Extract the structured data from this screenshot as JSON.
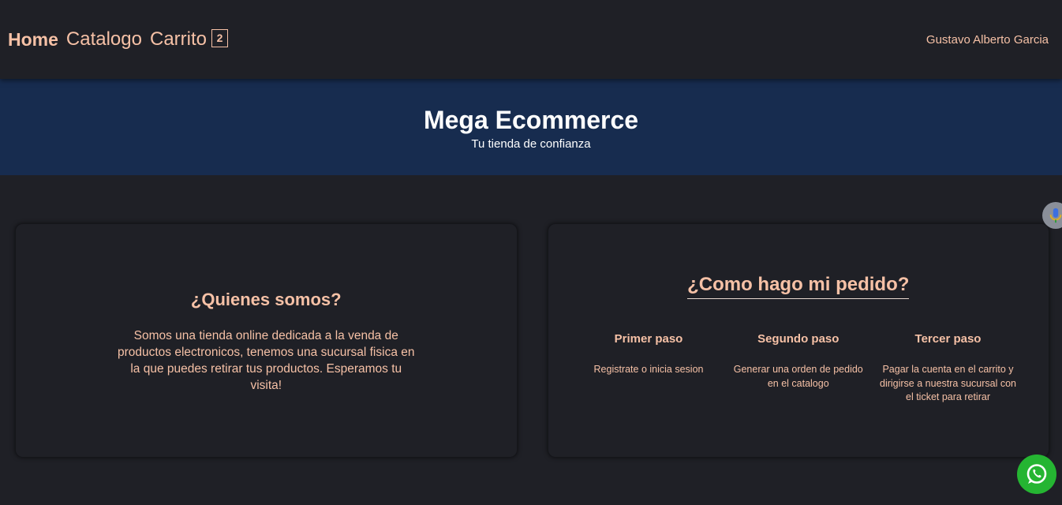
{
  "nav": {
    "home_label": "Home",
    "catalog_label": "Catalogo",
    "cart_label": "Carrito",
    "cart_count": "2",
    "user_name": "Gustavo Alberto Garcia"
  },
  "hero": {
    "title": "Mega Ecommerce",
    "subtitle": "Tu tienda de confianza"
  },
  "about": {
    "title": "¿Quienes somos?",
    "text": "Somos una tienda online dedicada a la venda de productos electronicos, tenemos una sucursal fisica en la que puedes retirar tus productos. Esperamos tu visita!"
  },
  "order": {
    "title": "¿Como hago mi pedido?",
    "steps": [
      {
        "title": "Primer paso",
        "text": "Registrate o inicia sesion"
      },
      {
        "title": "Segundo paso",
        "text": "Generar una orden de pedido en el catalogo"
      },
      {
        "title": "Tercer paso",
        "text": "Pagar la cuenta en el carrito y dirigirse a nuestra sucursal con el ticket para retirar"
      }
    ]
  },
  "icons": {
    "mic": "microphone-icon",
    "whatsapp": "whatsapp-icon"
  },
  "colors": {
    "background": "#1f2026",
    "accent": "#f6c1a6",
    "hero_background": "#172c4f",
    "whatsapp": "#25b532"
  }
}
